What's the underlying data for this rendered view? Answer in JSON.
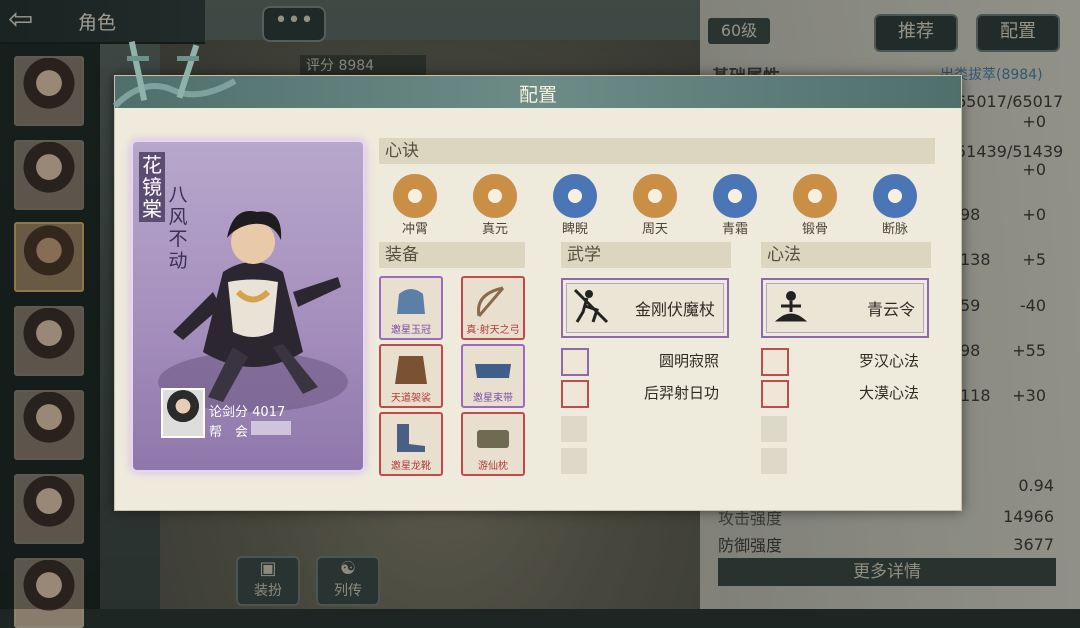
{
  "topbar": {
    "back_icon": "arrow-left-icon",
    "title": "角色",
    "chat_icon": "ellipsis-icon"
  },
  "background": {
    "score_label": "评分",
    "score_value": "8984"
  },
  "right_panel": {
    "level": "60级",
    "recommend_button": "推荐",
    "config_button": "配置",
    "base_attr_title": "基础属性",
    "base_attr_link": "出类拔萃(8984)",
    "stats": [
      {
        "value": "65017/65017",
        "delta": "+0"
      },
      {
        "value": "51439/51439",
        "delta": "+0"
      },
      {
        "value": "98",
        "delta": "+0"
      },
      {
        "value": "138",
        "delta": "+5"
      },
      {
        "value": "59",
        "delta": "-40"
      },
      {
        "value": "98",
        "delta": "+55"
      },
      {
        "value": "118",
        "delta": "+30"
      }
    ],
    "extra_value": "0.94",
    "attack_label": "攻击强度",
    "attack_value": "14966",
    "defense_label": "防御强度",
    "defense_value": "3677",
    "more_button": "更多详情"
  },
  "bottom_buttons": [
    {
      "label": "装扮",
      "icon": "costume-icon"
    },
    {
      "label": "列传",
      "icon": "biography-icon"
    }
  ],
  "modal": {
    "title": "配置",
    "character": {
      "name": "花镜棠",
      "title": "八风不动",
      "score_label": "论剑分",
      "score_value": "4017",
      "guild_label": "帮　会"
    },
    "sections": {
      "xinjue": "心诀",
      "equipment": "装备",
      "martial": "武学",
      "mental": "心法"
    },
    "xinjue": [
      {
        "name": "冲霄",
        "color": "#c98f45"
      },
      {
        "name": "真元",
        "color": "#c98f45"
      },
      {
        "name": "睥睨",
        "color": "#4a76b8"
      },
      {
        "name": "周天",
        "color": "#c98f45"
      },
      {
        "name": "青霜",
        "color": "#4a76b8"
      },
      {
        "name": "锻骨",
        "color": "#c98f45"
      },
      {
        "name": "断脉",
        "color": "#4a76b8"
      }
    ],
    "equipment": [
      {
        "name": "邀星玉冠",
        "tier": "purple",
        "color": "#5b7fa8"
      },
      {
        "name": "真·射天之弓",
        "tier": "red",
        "color": "#8b6a4a"
      },
      {
        "name": "天道袈裟",
        "tier": "red",
        "color": "#7a5232"
      },
      {
        "name": "邀星束带",
        "tier": "purple",
        "color": "#3f5f8a"
      },
      {
        "name": "邀星龙靴",
        "tier": "red",
        "color": "#4a5f85"
      },
      {
        "name": "游仙枕",
        "tier": "red",
        "color": "#6f6a52"
      }
    ],
    "martial": {
      "main": "金刚伏魔杖",
      "subs": [
        {
          "name": "圆明寂照",
          "tier": "purple"
        },
        {
          "name": "后羿射日功",
          "tier": "red"
        }
      ]
    },
    "mental": {
      "main": "青云令",
      "subs": [
        {
          "name": "罗汉心法",
          "tier": "red"
        },
        {
          "name": "大漠心法",
          "tier": "red"
        }
      ]
    }
  }
}
